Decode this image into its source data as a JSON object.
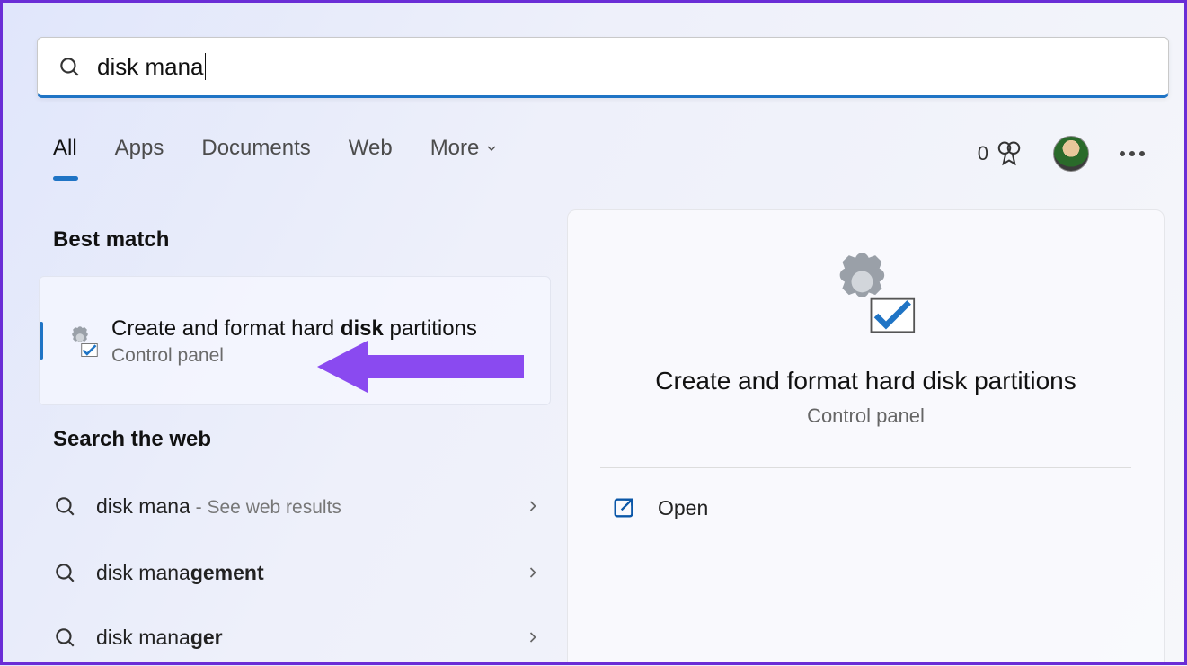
{
  "search": {
    "value": "disk mana"
  },
  "filters": {
    "all": "All",
    "apps": "Apps",
    "documents": "Documents",
    "web": "Web",
    "more": "More"
  },
  "rewards": {
    "count": "0"
  },
  "sections": {
    "best_match": "Best match",
    "search_web": "Search the web"
  },
  "best": {
    "title_pre": "Create and format hard ",
    "title_bold": "disk",
    "title_post": " partitions",
    "subtitle": "Control panel"
  },
  "web_results": {
    "r1_pre": "disk mana",
    "r1_hint": " - See web results",
    "r2_pre": "disk mana",
    "r2_bold": "gement",
    "r3_pre": "disk mana",
    "r3_bold": "ger"
  },
  "preview": {
    "title": "Create and format hard disk partitions",
    "subtitle": "Control panel",
    "open": "Open"
  }
}
